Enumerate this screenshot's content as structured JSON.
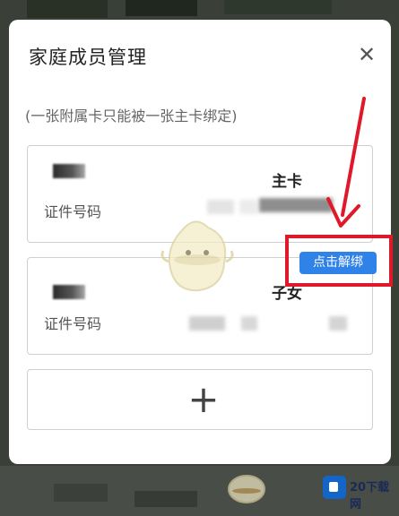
{
  "modal": {
    "title": "家庭成员管理",
    "close_icon": "close-icon",
    "note": "(一张附属卡只能被一张主卡绑定)"
  },
  "cards": [
    {
      "role": "主卡",
      "id_label": "证件号码"
    },
    {
      "role": "子女",
      "id_label": "证件号码",
      "action": "点击解绑"
    }
  ],
  "add_card": {
    "icon": "plus-icon"
  },
  "watermark": {
    "site": "20下载网"
  },
  "colors": {
    "accent": "#2f82e8",
    "highlight": "#e0192a"
  }
}
